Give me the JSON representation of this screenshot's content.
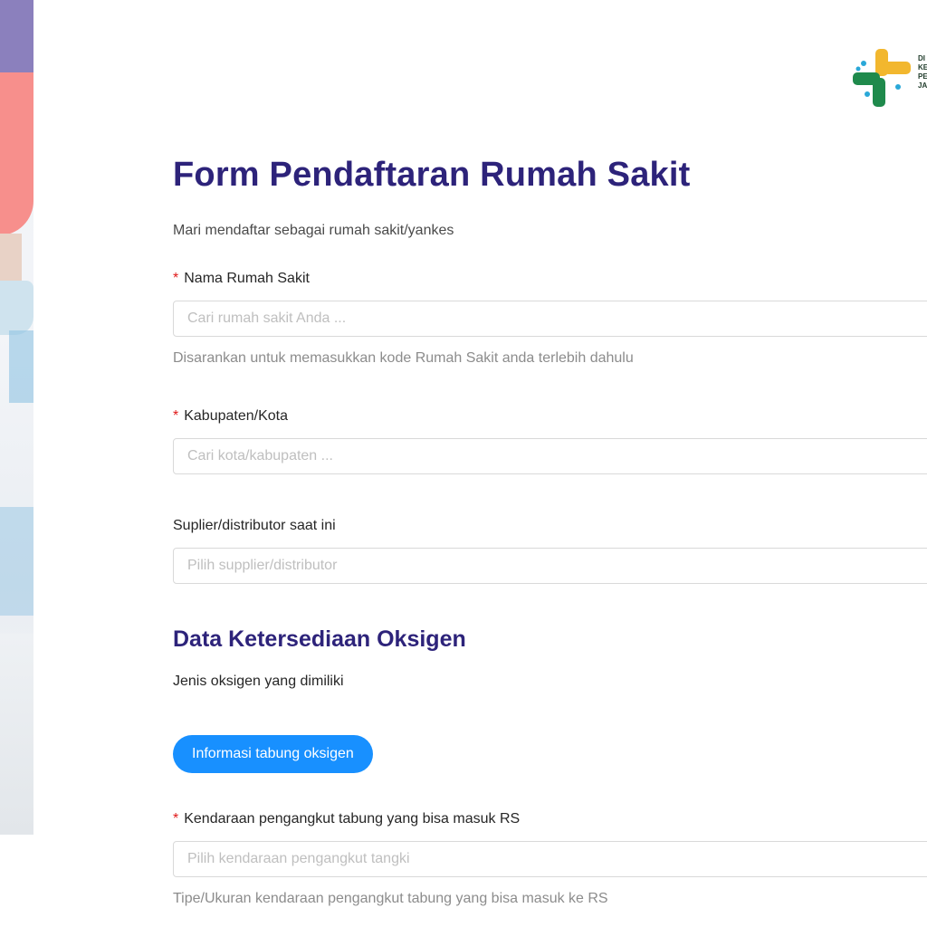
{
  "logo": {
    "text_lines": [
      "DI",
      "KE",
      "PE",
      "JA"
    ]
  },
  "form": {
    "title": "Form Pendaftaran Rumah Sakit",
    "subtitle": "Mari mendaftar sebagai rumah sakit/yankes",
    "required_mark": "*",
    "fields": [
      {
        "label": "Nama Rumah Sakit",
        "required": true,
        "placeholder": "Cari rumah sakit Anda ...",
        "help": "Disarankan untuk memasukkan kode Rumah Sakit anda terlebih dahulu"
      },
      {
        "label": "Kabupaten/Kota",
        "required": true,
        "placeholder": "Cari kota/kabupaten ..."
      },
      {
        "label": "Suplier/distributor saat ini",
        "required": false,
        "placeholder": "Pilih supplier/distributor"
      }
    ],
    "oxygen_section": {
      "title": "Data Ketersediaan Oksigen",
      "question": "Jenis oksigen yang dimiliki",
      "info_button": "Informasi tabung oksigen"
    },
    "vehicle_field": {
      "label": "Kendaraan pengangkut tabung yang bisa masuk RS",
      "required": true,
      "placeholder": "Pilih kendaraan pengangkut tangki",
      "help": "Tipe/Ukuran kendaraan pengangkut tabung yang bisa masuk ke RS"
    }
  },
  "colors": {
    "heading": "#2d237a",
    "primary": "#1890ff",
    "required": "#e01919"
  }
}
